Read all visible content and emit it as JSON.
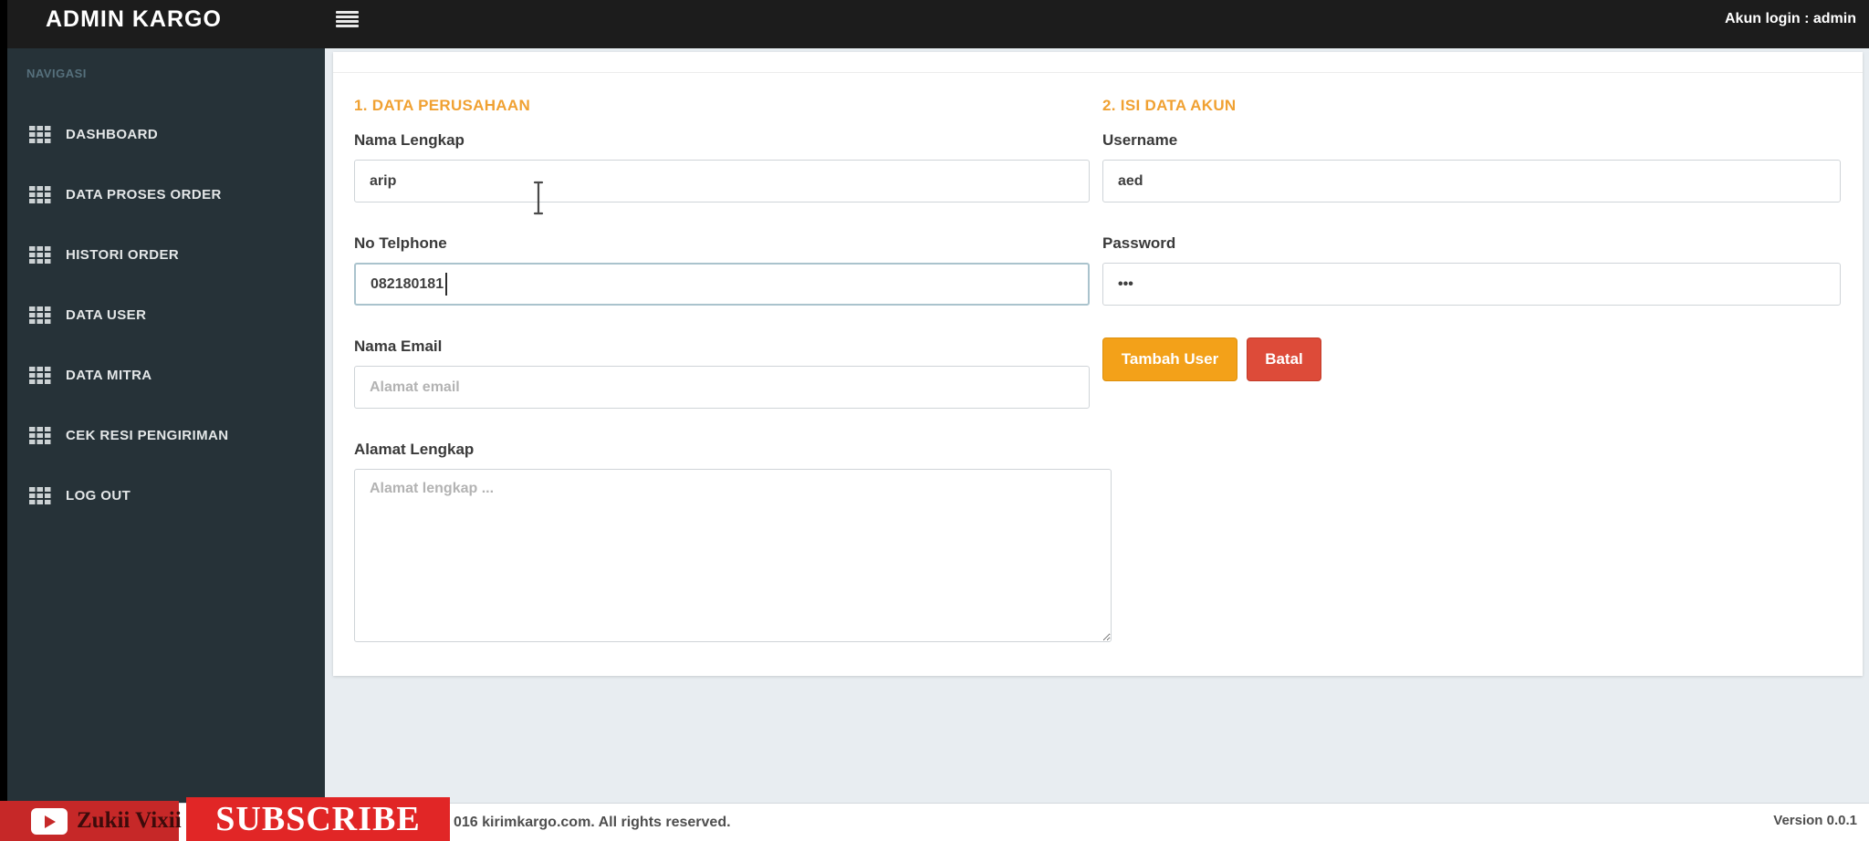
{
  "app": {
    "title": "ADMIN KARGO",
    "account_status": "Akun login : admin"
  },
  "sidebar": {
    "header": "NAVIGASI",
    "items": [
      "DASHBOARD",
      "DATA PROSES ORDER",
      "HISTORI ORDER",
      "DATA USER",
      "DATA MITRA",
      "CEK RESI PENGIRIMAN",
      "LOG OUT"
    ]
  },
  "form": {
    "left": {
      "heading": "1. DATA PERUSAHAAN",
      "nama_lengkap": {
        "label": "Nama Lengkap",
        "value": "arip"
      },
      "no_telphone": {
        "label": "No Telphone",
        "value": "082180181"
      },
      "nama_email": {
        "label": "Nama Email",
        "placeholder": "Alamat email"
      },
      "alamat_lengkap": {
        "label": "Alamat Lengkap",
        "placeholder": "Alamat lengkap ..."
      }
    },
    "right": {
      "heading": "2. ISI DATA AKUN",
      "username": {
        "label": "Username",
        "value": "aed"
      },
      "password": {
        "label": "Password",
        "value": "•••"
      },
      "submit_label": "Tambah User",
      "cancel_label": "Batal"
    }
  },
  "footer": {
    "copyright": "016 kirimkargo.com. All rights reserved.",
    "version": "Version 0.0.1"
  },
  "watermark": {
    "channel": "Zukii Vixii",
    "subscribe": "SUBSCRIBE"
  },
  "colors": {
    "navbar_bg": "#1c1c1c",
    "sidebar_bg": "#263238",
    "content_bg": "#e8edf1",
    "heading_accent": "#f0a132",
    "submit_button": "#f3a119",
    "cancel_button": "#dd4b39",
    "banner_red": "#e12626",
    "focused_input_border": "#aac3cd"
  }
}
